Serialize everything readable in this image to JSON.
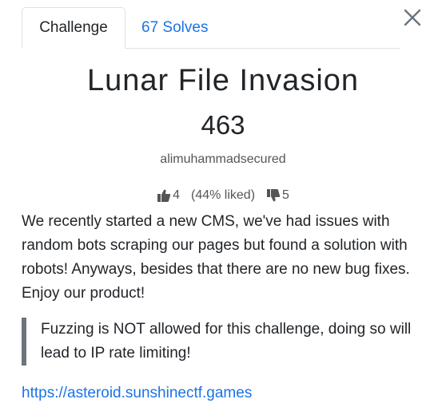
{
  "tabs": [
    {
      "label": "Challenge"
    },
    {
      "label": "67 Solves"
    }
  ],
  "close": {
    "icon": "close-icon"
  },
  "challenge": {
    "name": "Lunar File Invasion",
    "value": "463",
    "author": "alimuhammadsecured",
    "votes": {
      "likes": "4",
      "percent": "(44% liked)",
      "dislikes": "5",
      "like_icon": "thumbs-up-icon",
      "dislike_icon": "thumbs-down-icon"
    },
    "description": "We recently started a new CMS, we've had issues with random bots scraping our pages but found a solution with robots! Anyways, besides that there are no new bug fixes. Enjoy our product!",
    "note": "Fuzzing is NOT allowed for this challenge, doing so will lead to IP rate limiting!",
    "url": "https://asteroid.sunshinectf.games"
  },
  "colors": {
    "accent": "#1a73e8",
    "quote_border": "#6c757d",
    "text": "#212529",
    "muted": "#555555"
  }
}
